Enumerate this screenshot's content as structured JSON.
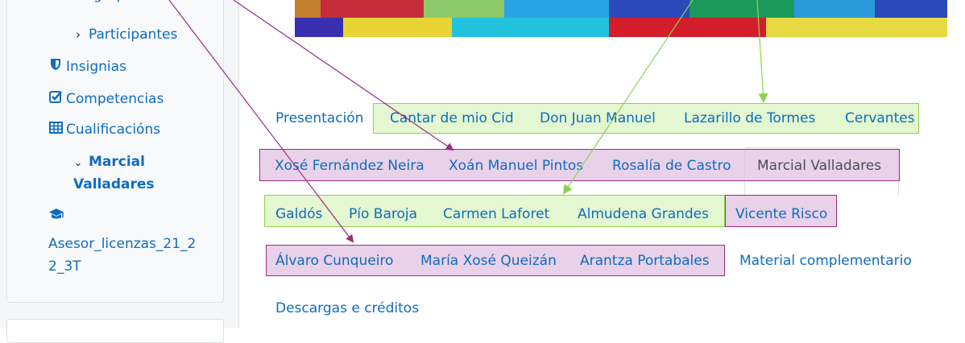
{
  "drawer": {
    "partial_item": "iongrupo",
    "items": [
      {
        "label": "Participantes",
        "icon": "chevron-right-icon"
      },
      {
        "label": "Insignias",
        "icon": "shield-icon"
      },
      {
        "label": "Competencias",
        "icon": "checkbox-icon"
      },
      {
        "label": "Cualificacións",
        "icon": "table-grid-icon"
      },
      {
        "label": "Marcial",
        "label2": "Valladares",
        "icon": "chevron-down-icon"
      },
      {
        "label": "Asesor_licenzas_21_2",
        "label2": "2_3T",
        "icon": "graduation-cap-icon"
      }
    ]
  },
  "tabs": {
    "row1": [
      "Presentación",
      "Cantar de mio Cid",
      "Don Juan Manuel",
      "Lazarillo de Tormes",
      "Cervantes"
    ],
    "row2": [
      "Xosé Fernández Neira",
      "Xoán Manuel Pintos",
      "Rosalía de Castro",
      "Marcial Valladares"
    ],
    "row3": [
      "Galdós",
      "Pío Baroja",
      "Carmen Laforet",
      "Almudena Grandes",
      "Vicente Risco"
    ],
    "row4": [
      "Álvaro Cunqueiro",
      "María Xosé Queizán",
      "Arantza Portabales",
      "Material complementario"
    ],
    "row5": [
      "Descargas e créditos"
    ],
    "active": "Marcial Valladares"
  },
  "colors": {
    "link": "#0f6cbf",
    "active_tab": "#495057",
    "group_green_border": "#8fd14f",
    "group_purple_border": "#9c2a83"
  }
}
